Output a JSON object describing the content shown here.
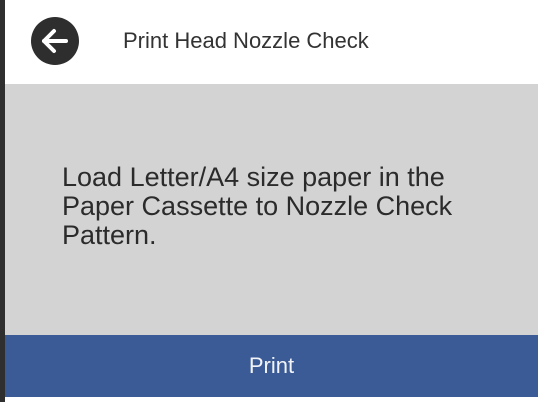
{
  "header": {
    "title": "Print Head Nozzle Check",
    "back_icon": "arrow-left-icon"
  },
  "panel": {
    "message_line1": "Load Letter/A4 size paper in the",
    "message_line2": "Paper Cassette to Nozzle Check",
    "message_line3": "Pattern."
  },
  "footer": {
    "print_label": "Print"
  },
  "colors": {
    "header_bg": "#ffffff",
    "panel_bg": "#d3d3d3",
    "accent": "#3b5b97",
    "back_button_bg": "#2e2e2e"
  }
}
